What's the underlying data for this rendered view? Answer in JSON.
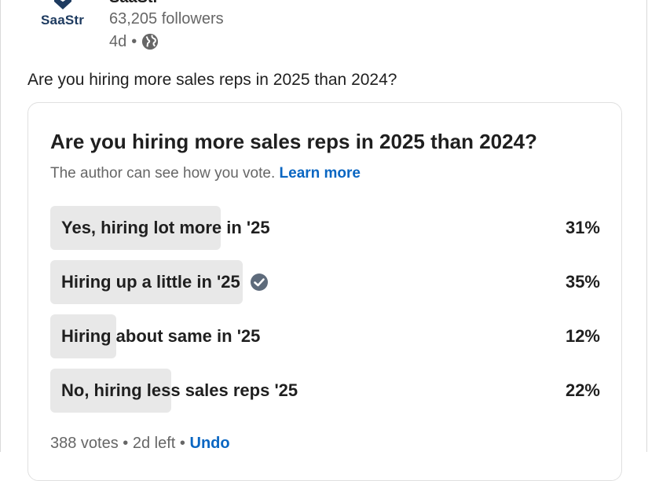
{
  "header": {
    "logo_text": "SaaStr",
    "author_name": "SaaStr",
    "followers": "63,205 followers",
    "time_ago": "4d",
    "separator": "•",
    "visibility_icon": "globe-icon"
  },
  "post": {
    "text": "Are you hiring more sales reps in 2025 than 2024?"
  },
  "poll": {
    "title": "Are you hiring more sales reps in 2025 than 2024?",
    "note": "The author can see how you vote.",
    "learn_more": "Learn more",
    "options": [
      {
        "label": "Yes, hiring lot more in '25",
        "percent": "31%",
        "fraction": 0.31,
        "selected": false
      },
      {
        "label": "Hiring up a little in '25",
        "percent": "35%",
        "fraction": 0.35,
        "selected": true
      },
      {
        "label": "Hiring about same in '25",
        "percent": "12%",
        "fraction": 0.12,
        "selected": false
      },
      {
        "label": "No, hiring less sales reps '25",
        "percent": "22%",
        "fraction": 0.22,
        "selected": false
      }
    ],
    "votes": "388 votes",
    "time_left": "2d left",
    "separator": "•",
    "undo": "Undo"
  },
  "colors": {
    "link": "#0a66c2",
    "bar_fill": "#e8e8e8",
    "muted_text": "#666666",
    "check": "#5e6b7b"
  }
}
